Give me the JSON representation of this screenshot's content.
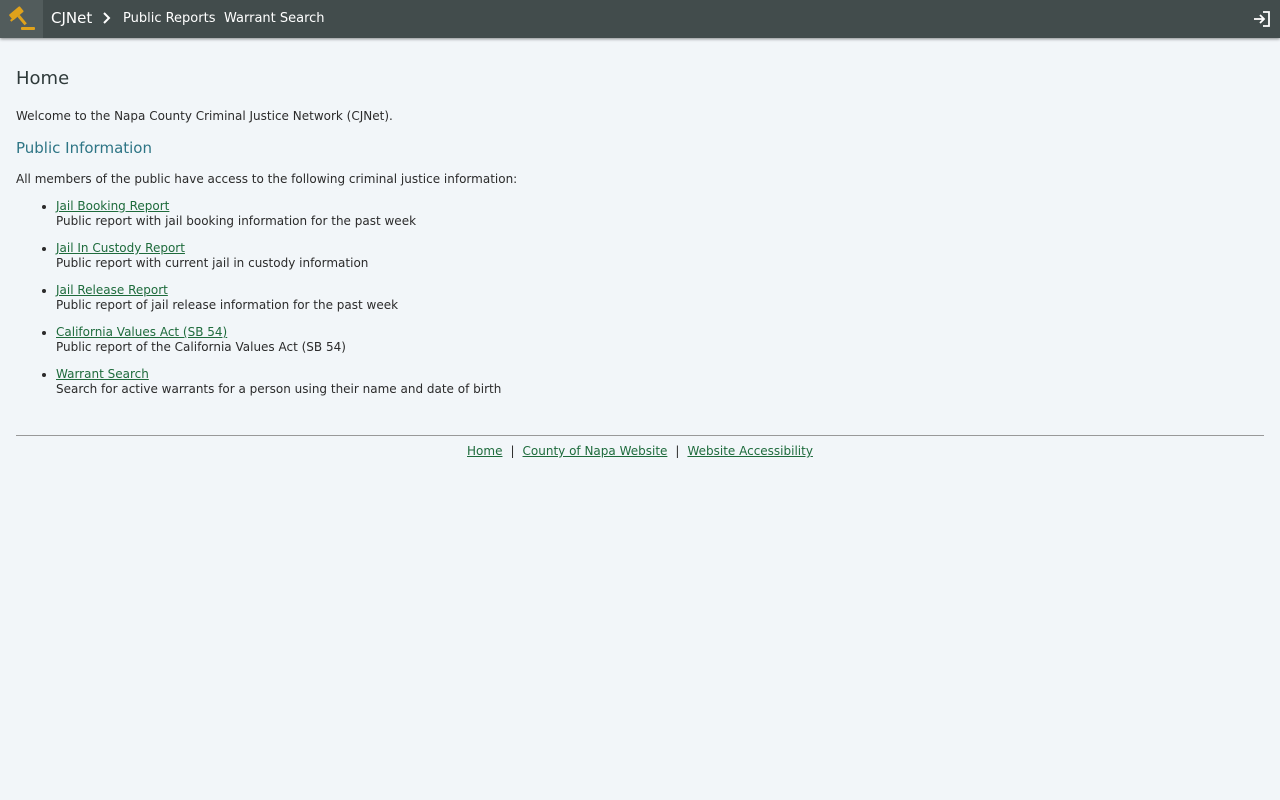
{
  "header": {
    "brand": "CJNet",
    "nav": [
      {
        "label": "Public Reports"
      },
      {
        "label": "Warrant Search"
      }
    ],
    "colors": {
      "bar": "#424c4c",
      "logo_bg": "#525c5c",
      "logo_accent": "#e0a21b"
    }
  },
  "page": {
    "title": "Home",
    "welcome": "Welcome to the Napa County Criminal Justice Network (CJNet).",
    "section_title": "Public Information",
    "intro": "All members of the public have access to the following criminal justice information:",
    "items": [
      {
        "link": "Jail Booking Report",
        "desc": "Public report with jail booking information for the past week"
      },
      {
        "link": "Jail In Custody Report",
        "desc": "Public report with current jail in custody information"
      },
      {
        "link": "Jail Release Report",
        "desc": "Public report of jail release information for the past week"
      },
      {
        "link": "California Values Act (SB 54)",
        "desc": "Public report of the California Values Act (SB 54)"
      },
      {
        "link": "Warrant Search",
        "desc": "Search for active warrants for a person using their name and date of birth"
      }
    ]
  },
  "footer": {
    "links": [
      {
        "label": "Home"
      },
      {
        "label": "County of Napa Website"
      },
      {
        "label": "Website Accessibility"
      }
    ],
    "separator": "|"
  },
  "icons": {
    "logo": "gavel-icon",
    "breadcrumb": "chevron-right-icon",
    "login": "sign-in-icon"
  }
}
